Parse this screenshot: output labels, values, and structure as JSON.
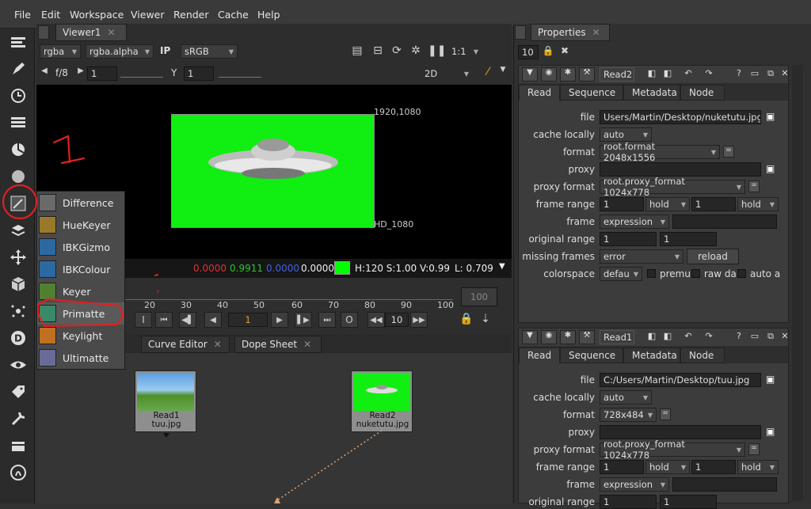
{
  "menu": [
    "File",
    "Edit",
    "Workspace",
    "Viewer",
    "Render",
    "Cache",
    "Help"
  ],
  "viewer": {
    "tab_label": "Viewer1",
    "channels": "rgba",
    "alpha_channel": "rgba.alpha",
    "ip_label": "IP",
    "colorspace": "sRGB",
    "zoom": "1:1",
    "fstop": "f/8",
    "gain": "1",
    "gamma_label": "Y",
    "gamma": "1",
    "view_mode": "2D",
    "format_top": "1920,1080",
    "format_bottom": "HD_1080",
    "pixel_r": "0.0000",
    "pixel_g": "0.9911",
    "pixel_b": "0.0000",
    "pixel_a": "0.0000",
    "hsv": "H:120 S:1.00 V:0.99",
    "luma": "L: 0.709",
    "swatch_color": "#00ff00",
    "canvas_color": "#11ee11"
  },
  "timeline": {
    "ticks": [
      "20",
      "30",
      "40",
      "50",
      "60",
      "70",
      "80",
      "90",
      "100"
    ],
    "end_frame": "100",
    "current_frame": "1",
    "step": "10",
    "in_label": "I",
    "out_label": "O"
  },
  "nodegraph": {
    "tabs": [
      "Curve Editor",
      "Dope Sheet"
    ],
    "nodes": [
      {
        "name": "Read1",
        "file": "tuu.jpg"
      },
      {
        "name": "Read2",
        "file": "nuketutu.jpg"
      }
    ]
  },
  "popup_menu": {
    "items": [
      "Difference",
      "HueKeyer",
      "IBKGizmo",
      "IBKColour",
      "Keyer",
      "Primatte",
      "Keylight",
      "Ultimatte"
    ],
    "highlighted": "Primatte"
  },
  "annotations": {
    "mark_1": "1",
    "mark_2": "2"
  },
  "properties": {
    "tab_label": "Properties",
    "max_panels": "10",
    "panels": [
      {
        "node_name": "Read2",
        "tabs": [
          "Read",
          "Sequence",
          "Metadata",
          "Node"
        ],
        "file": "Users/Martin/Desktop/nuketutu.jpg",
        "cache_locally": "auto",
        "format": "root.format 2048x1556",
        "proxy": "",
        "proxy_format": "root.proxy_format 1024x778",
        "frame_range_start": "1",
        "frame_range_start_mode": "hold",
        "frame_range_end": "1",
        "frame_range_end_mode": "hold",
        "frame": "expression",
        "original_range_start": "1",
        "original_range_end": "1",
        "missing_frames": "error",
        "reload_label": "reload",
        "colorspace": "defau",
        "premult_label": "premu",
        "raw_label": "raw da",
        "auto_alpha_label": "auto a"
      },
      {
        "node_name": "Read1",
        "tabs": [
          "Read",
          "Sequence",
          "Metadata",
          "Node"
        ],
        "file": "C:/Users/Martin/Desktop/tuu.jpg",
        "cache_locally": "auto",
        "format": "728x484",
        "proxy": "",
        "proxy_format": "root.proxy_format 1024x778",
        "frame_range_start": "1",
        "frame_range_start_mode": "hold",
        "frame_range_end": "1",
        "frame_range_end_mode": "hold",
        "frame": "expression",
        "original_range_label": "original range",
        "original_range_start": "1",
        "original_range_end": "1"
      }
    ],
    "labels": {
      "file": "file",
      "cache_locally": "cache locally",
      "format": "format",
      "proxy": "proxy",
      "proxy_format": "proxy format",
      "frame_range": "frame range",
      "frame": "frame",
      "original_range": "original range",
      "missing_frames": "missing frames",
      "colorspace": "colorspace"
    }
  }
}
